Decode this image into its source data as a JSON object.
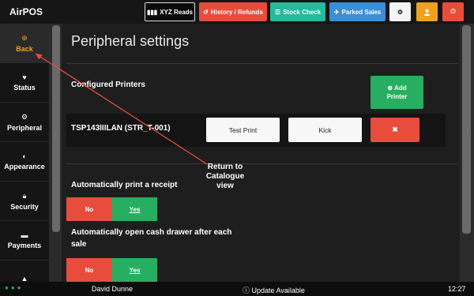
{
  "app": {
    "brand": "AirPOS"
  },
  "toolbar": {
    "xyz_reads": "XYZ Reads",
    "history_refunds": "History / Refunds",
    "stock_check": "Stock Check",
    "parked_sales": "Parked Sales",
    "colors": {
      "xyz": "#0b0b0b",
      "history": "#e74c3c",
      "stock": "#26b99a",
      "parked": "#3a8fd9",
      "user": "#f0a020",
      "power": "#e74c3c"
    }
  },
  "sidebar": {
    "items": [
      {
        "label": "Back",
        "icon": "back-circle-icon",
        "active": true
      },
      {
        "label": "Status",
        "icon": "heartbeat-icon"
      },
      {
        "label": "Peripheral",
        "icon": "gear-icon"
      },
      {
        "label": "Appearance",
        "icon": "contrast-icon"
      },
      {
        "label": "Security",
        "icon": "lock-icon"
      },
      {
        "label": "Payments",
        "icon": "cart-icon"
      },
      {
        "label": "",
        "icon": "warning-icon"
      }
    ]
  },
  "main": {
    "title": "Peripheral settings",
    "configured_printers": "Configured Printers",
    "add_printer_line1": "Add",
    "add_printer_line2": "Printer",
    "printer": {
      "name": "TSP143IIILAN (STR_T-001)",
      "test_print": "Test Print",
      "kick": "Kick",
      "delete": "✖"
    },
    "auto_print": {
      "label": "Automatically print a receipt",
      "no": "No",
      "yes": "Yes"
    },
    "auto_drawer": {
      "label_line1": "Automatically open cash drawer after each",
      "label_line2": "sale",
      "no": "No",
      "yes": "Yes"
    }
  },
  "annotation": {
    "line1": "Return to",
    "line2": "Catalogue",
    "line3": "view"
  },
  "statusbar": {
    "user": "David Dunne",
    "update": "Update Available",
    "time": "12:27"
  }
}
